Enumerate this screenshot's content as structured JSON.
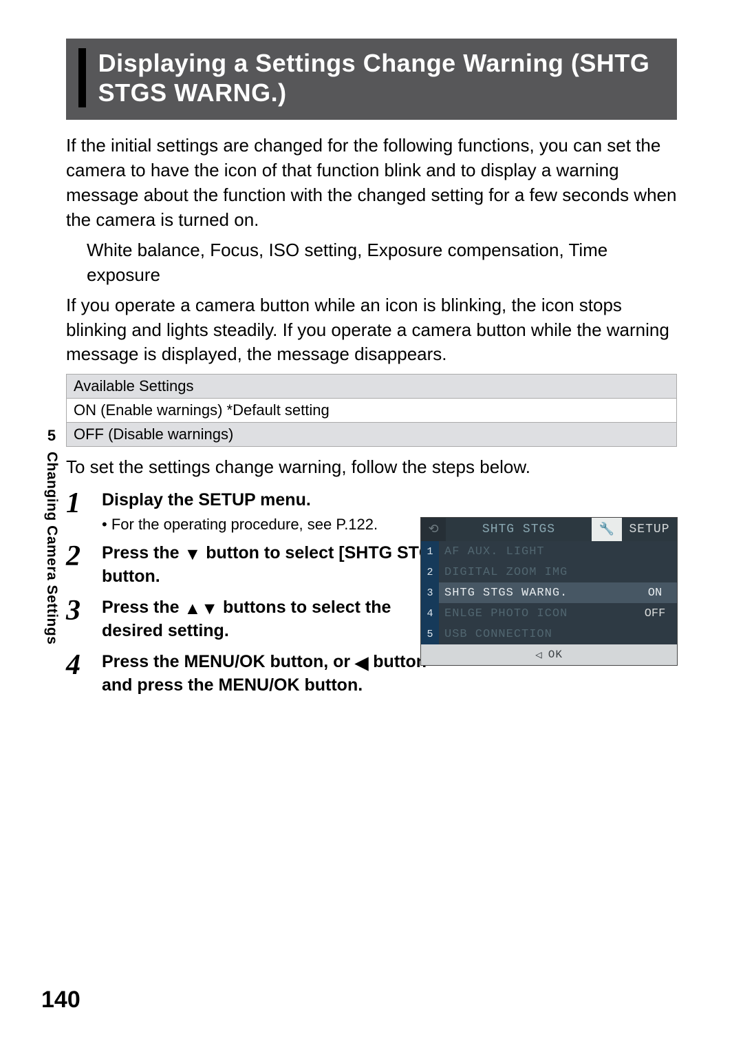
{
  "title": "Displaying a Settings Change Warning (SHTG STGS WARNG.)",
  "para1": "If the initial settings are changed for the following functions, you can set the camera to have the icon of that function blink and to display a warning message about the function with the changed setting for a few seconds when the camera is turned on.",
  "para1_indent": "White balance, Focus, ISO setting, Exposure compensation, Time exposure",
  "para2": "If you operate a camera button while an icon is blinking, the icon stops blinking and lights steadily. If you operate a camera button while the warning message is displayed, the message disappears.",
  "settings": {
    "header": "Available Settings",
    "rows": [
      "ON (Enable warnings) *Default setting",
      "OFF (Disable warnings)"
    ]
  },
  "lead": "To set the settings change warning, follow the steps below.",
  "steps": [
    {
      "num": "1",
      "title": "Display the SETUP menu.",
      "sub": "For the operating procedure, see P.122."
    },
    {
      "num": "2",
      "title_pre": "Press the ",
      "title_mid": " button to select [SHTG STGS WARNG.] and press the ",
      "title_post": " button."
    },
    {
      "num": "3",
      "title_pre": "Press the ",
      "title_post": " buttons to select the desired setting."
    },
    {
      "num": "4",
      "title_pre": "Press the MENU/OK button, or ",
      "title_post": " button and press the MENU/OK button."
    }
  ],
  "sidebar": {
    "chapter": "5",
    "label": "Changing Camera Settings"
  },
  "page_number": "140",
  "screenshot": {
    "tab_left_icon": "⟲",
    "tab_active": "SHTG STGS",
    "tab_wrench": "🔧",
    "tab_right": "SETUP",
    "rows": [
      {
        "idx": "1",
        "label": "AF AUX. LIGHT",
        "val": ""
      },
      {
        "idx": "2",
        "label": "DIGITAL ZOOM IMG",
        "val": ""
      },
      {
        "idx": "3",
        "label": "SHTG STGS WARNG.",
        "val_on": "ON",
        "val_off": "",
        "selected": true
      },
      {
        "idx": "4",
        "label": "ENLGE PHOTO ICON",
        "val": "OFF"
      },
      {
        "idx": "5",
        "label": "USB CONNECTION",
        "val": ""
      }
    ],
    "footer_arrow": "◁",
    "footer_ok": "OK"
  }
}
